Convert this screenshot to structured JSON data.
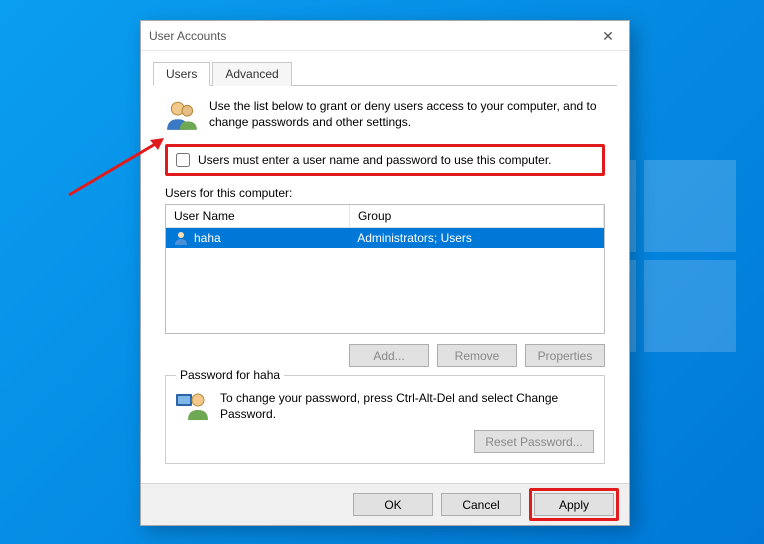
{
  "window": {
    "title": "User Accounts"
  },
  "tabs": {
    "users": "Users",
    "advanced": "Advanced"
  },
  "intro": "Use the list below to grant or deny users access to your computer, and to change passwords and other settings.",
  "checkbox_label": "Users must enter a user name and password to use this computer.",
  "users_label": "Users for this computer:",
  "columns": {
    "username": "User Name",
    "group": "Group"
  },
  "users": [
    {
      "name": "haha",
      "group": "Administrators; Users"
    }
  ],
  "buttons": {
    "add": "Add...",
    "remove": "Remove",
    "properties": "Properties",
    "ok": "OK",
    "cancel": "Cancel",
    "apply": "Apply",
    "reset": "Reset Password..."
  },
  "password_group": {
    "title": "Password for haha",
    "text": "To change your password, press Ctrl-Alt-Del and select Change Password."
  }
}
